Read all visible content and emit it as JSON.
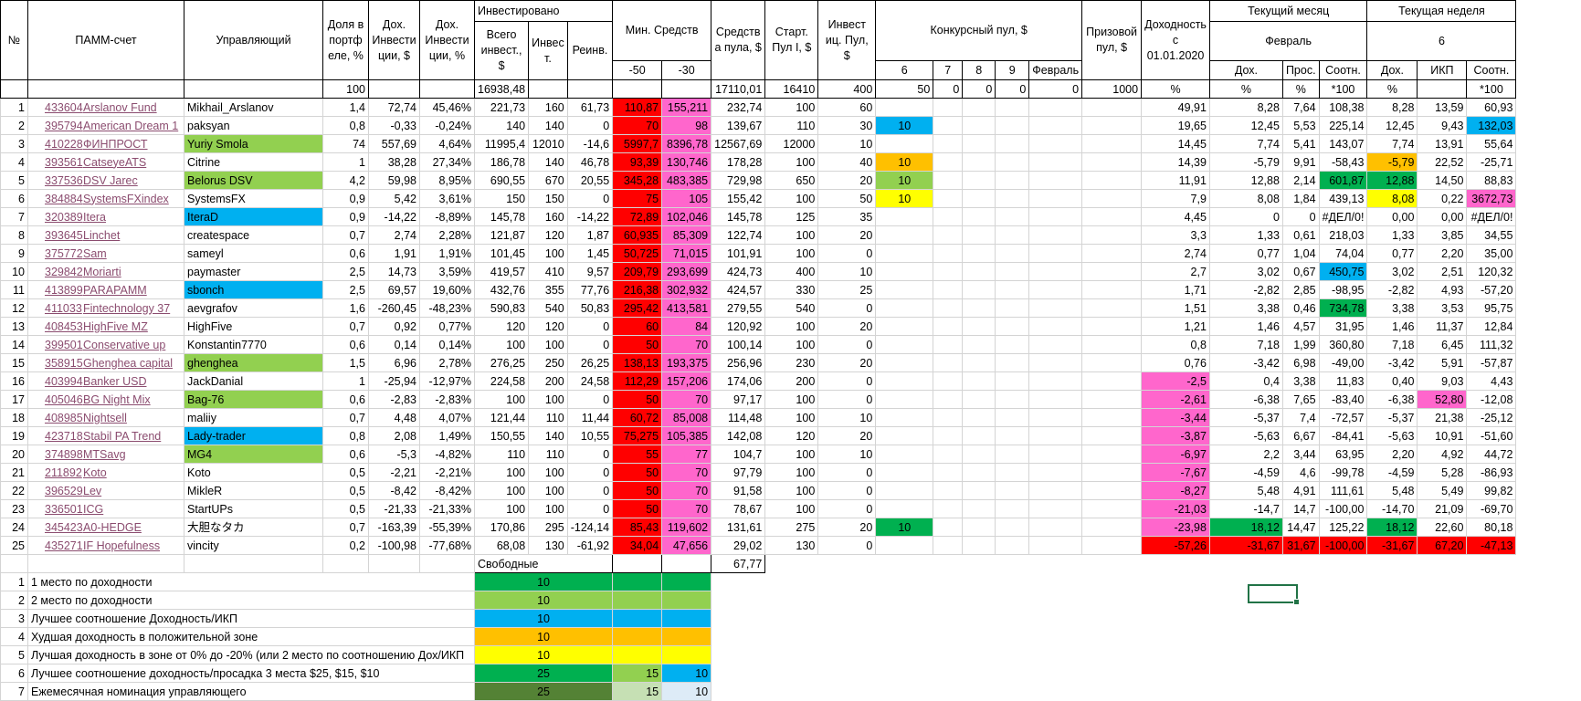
{
  "colors": {
    "dkgreen": "#00b050",
    "ltgreen": "#92d050",
    "blue": "#00b0f0",
    "orange": "#ffc000",
    "yellow": "#ffff00",
    "red": "#ff0000",
    "pink": "#ff66cc",
    "olive": "#548235",
    "pale_green": "#c6e0b4",
    "pale_blue": "#ddebf7"
  },
  "header": {
    "no": "№",
    "pamm": "ПАММ-счет",
    "manager": "Управляющий",
    "share": "Доля в портф еле, %",
    "inc_usd": "Дох. Инвести ции, $",
    "inc_pct": "Дох. Инвести ции, %",
    "invested": "Инвестировано",
    "total_inv": "Всего инвест., $",
    "invest": "Инвес т.",
    "reinv": "Реинв.",
    "min_funds": "Мин. Средств",
    "m50": "-50",
    "m30": "-30",
    "pool_funds": "Средств а пула, $",
    "start_pool": "Старт. Пул I, $",
    "inv_pool": "Инвест иц. Пул, $",
    "contest_pool": "Конкурсный пул, $",
    "c6": "6",
    "c7": "7",
    "c8": "8",
    "c9": "9",
    "feb": "Февраль",
    "prize_pool": "Призовой пул, $",
    "yield": "Доходность с 01.01.2020",
    "cur_month": "Текущий месяц",
    "month_name": "Февраль",
    "cur_week": "Текущая неделя",
    "week_no": "6",
    "m_inc": "Дох.",
    "m_dd": "Прос.",
    "m_ratio": "Соотн.",
    "w_inc": "Дох.",
    "w_ikp": "ИКП",
    "w_ratio": "Соотн."
  },
  "totals": [
    "100",
    "",
    "",
    "16938,48",
    "",
    "",
    "",
    "",
    "17110,01",
    "16410",
    "400",
    "50",
    "0",
    "0",
    "0",
    "0",
    "1000",
    "%",
    "%",
    "%",
    "*100",
    "%",
    "",
    "*100"
  ],
  "rows": [
    {
      "n": "1",
      "id": "433604",
      "name": "Arslanov Fund",
      "mgr": "Mikhail_Arslanov",
      "share": "1,4",
      "inc": "72,74",
      "pct": "45,46%",
      "tot": "221,73",
      "inv": "160",
      "reinv": "61,73",
      "m50": "110,87",
      "m30": "155,211",
      "pool": "232,74",
      "start": "100",
      "ip": "60",
      "c6": "",
      "yld": "49,91",
      "md": "8,28",
      "mp": "7,64",
      "mr": "108,38",
      "wd": "8,28",
      "wi": "13,59",
      "wr": "60,93"
    },
    {
      "n": "2",
      "id": "395794",
      "name": "American Dream 1",
      "mgr": "paksyan",
      "share": "0,8",
      "inc": "-0,33",
      "pct": "-0,24%",
      "tot": "140",
      "inv": "140",
      "reinv": "0",
      "m50": "70",
      "m30": "98",
      "pool": "139,67",
      "start": "110",
      "ip": "30",
      "c6": "10",
      "yld": "19,65",
      "md": "12,45",
      "mp": "5,53",
      "mr": "225,14",
      "wd": "12,45",
      "wi": "9,43",
      "wr": "132,03"
    },
    {
      "n": "3",
      "id": "410228",
      "name": "ФИНПРОСТ",
      "mgr": "Yuriy Smola",
      "share": "74",
      "inc": "557,69",
      "pct": "4,64%",
      "tot": "11995,4",
      "inv": "12010",
      "reinv": "-14,6",
      "m50": "5997,7",
      "m30": "8396,78",
      "pool": "12567,69",
      "start": "12000",
      "ip": "10",
      "c6": "",
      "yld": "14,45",
      "md": "7,74",
      "mp": "5,41",
      "mr": "143,07",
      "wd": "7,74",
      "wi": "13,91",
      "wr": "55,64"
    },
    {
      "n": "4",
      "id": "393561",
      "name": "CatseyeATS",
      "mgr": "Citrine",
      "share": "1",
      "inc": "38,28",
      "pct": "27,34%",
      "tot": "186,78",
      "inv": "140",
      "reinv": "46,78",
      "m50": "93,39",
      "m30": "130,746",
      "pool": "178,28",
      "start": "100",
      "ip": "40",
      "c6": "10",
      "yld": "14,39",
      "md": "-5,79",
      "mp": "9,91",
      "mr": "-58,43",
      "wd": "-5,79",
      "wi": "22,52",
      "wr": "-25,71"
    },
    {
      "n": "5",
      "id": "337536",
      "name": "DSV Jarec",
      "mgr": "Belorus DSV",
      "share": "4,2",
      "inc": "59,98",
      "pct": "8,95%",
      "tot": "690,55",
      "inv": "670",
      "reinv": "20,55",
      "m50": "345,28",
      "m30": "483,385",
      "pool": "729,98",
      "start": "650",
      "ip": "20",
      "c6": "10",
      "yld": "11,91",
      "md": "12,88",
      "mp": "2,14",
      "mr": "601,87",
      "wd": "12,88",
      "wi": "14,50",
      "wr": "88,83"
    },
    {
      "n": "6",
      "id": "384884",
      "name": "SystemsFXindex",
      "mgr": "SystemsFX",
      "share": "0,9",
      "inc": "5,42",
      "pct": "3,61%",
      "tot": "150",
      "inv": "150",
      "reinv": "0",
      "m50": "75",
      "m30": "105",
      "pool": "155,42",
      "start": "100",
      "ip": "50",
      "c6": "10",
      "yld": "7,9",
      "md": "8,08",
      "mp": "1,84",
      "mr": "439,13",
      "wd": "8,08",
      "wi": "0,22",
      "wr": "3672,73"
    },
    {
      "n": "7",
      "id": "320389",
      "name": "Itera",
      "mgr": "IteraD",
      "share": "0,9",
      "inc": "-14,22",
      "pct": "-8,89%",
      "tot": "145,78",
      "inv": "160",
      "reinv": "-14,22",
      "m50": "72,89",
      "m30": "102,046",
      "pool": "145,78",
      "start": "125",
      "ip": "35",
      "c6": "",
      "yld": "4,45",
      "md": "0",
      "mp": "0",
      "mr": "#ДЕЛ/0!",
      "wd": "0,00",
      "wi": "0,00",
      "wr": "#ДЕЛ/0!"
    },
    {
      "n": "8",
      "id": "393645",
      "name": "Linchet",
      "mgr": "createspace",
      "share": "0,7",
      "inc": "2,74",
      "pct": "2,28%",
      "tot": "121,87",
      "inv": "120",
      "reinv": "1,87",
      "m50": "60,935",
      "m30": "85,309",
      "pool": "122,74",
      "start": "100",
      "ip": "20",
      "c6": "",
      "yld": "3,3",
      "md": "1,33",
      "mp": "0,61",
      "mr": "218,03",
      "wd": "1,33",
      "wi": "3,85",
      "wr": "34,55"
    },
    {
      "n": "9",
      "id": "375772",
      "name": "Sam",
      "mgr": "sameyl",
      "share": "0,6",
      "inc": "1,91",
      "pct": "1,91%",
      "tot": "101,45",
      "inv": "100",
      "reinv": "1,45",
      "m50": "50,725",
      "m30": "71,015",
      "pool": "101,91",
      "start": "100",
      "ip": "0",
      "c6": "",
      "yld": "2,74",
      "md": "0,77",
      "mp": "1,04",
      "mr": "74,04",
      "wd": "0,77",
      "wi": "2,20",
      "wr": "35,00"
    },
    {
      "n": "10",
      "id": "329842",
      "name": "Moriarti",
      "mgr": "paymaster",
      "share": "2,5",
      "inc": "14,73",
      "pct": "3,59%",
      "tot": "419,57",
      "inv": "410",
      "reinv": "9,57",
      "m50": "209,79",
      "m30": "293,699",
      "pool": "424,73",
      "start": "400",
      "ip": "10",
      "c6": "",
      "yld": "2,7",
      "md": "3,02",
      "mp": "0,67",
      "mr": "450,75",
      "wd": "3,02",
      "wi": "2,51",
      "wr": "120,32"
    },
    {
      "n": "11",
      "id": "413899",
      "name": "PARAPAMM",
      "mgr": "sbonch",
      "share": "2,5",
      "inc": "69,57",
      "pct": "19,60%",
      "tot": "432,76",
      "inv": "355",
      "reinv": "77,76",
      "m50": "216,38",
      "m30": "302,932",
      "pool": "424,57",
      "start": "330",
      "ip": "25",
      "c6": "",
      "yld": "1,71",
      "md": "-2,82",
      "mp": "2,85",
      "mr": "-98,95",
      "wd": "-2,82",
      "wi": "4,93",
      "wr": "-57,20"
    },
    {
      "n": "12",
      "id": "411033",
      "name": "Fintechnology 37",
      "mgr": "aevgrafov",
      "share": "1,6",
      "inc": "-260,45",
      "pct": "-48,23%",
      "tot": "590,83",
      "inv": "540",
      "reinv": "50,83",
      "m50": "295,42",
      "m30": "413,581",
      "pool": "279,55",
      "start": "540",
      "ip": "0",
      "c6": "",
      "yld": "1,51",
      "md": "3,38",
      "mp": "0,46",
      "mr": "734,78",
      "wd": "3,38",
      "wi": "3,53",
      "wr": "95,75"
    },
    {
      "n": "13",
      "id": "408453",
      "name": "HighFive MZ",
      "mgr": "HighFive",
      "share": "0,7",
      "inc": "0,92",
      "pct": "0,77%",
      "tot": "120",
      "inv": "120",
      "reinv": "0",
      "m50": "60",
      "m30": "84",
      "pool": "120,92",
      "start": "100",
      "ip": "20",
      "c6": "",
      "yld": "1,21",
      "md": "1,46",
      "mp": "4,57",
      "mr": "31,95",
      "wd": "1,46",
      "wi": "11,37",
      "wr": "12,84"
    },
    {
      "n": "14",
      "id": "399501",
      "name": "Conservative up",
      "mgr": "Konstantin7770",
      "share": "0,6",
      "inc": "0,14",
      "pct": "0,14%",
      "tot": "100",
      "inv": "100",
      "reinv": "0",
      "m50": "50",
      "m30": "70",
      "pool": "100,14",
      "start": "100",
      "ip": "0",
      "c6": "",
      "yld": "0,8",
      "md": "7,18",
      "mp": "1,99",
      "mr": "360,80",
      "wd": "7,18",
      "wi": "6,45",
      "wr": "111,32"
    },
    {
      "n": "15",
      "id": "358915",
      "name": "Ghenghea capital",
      "mgr": "ghenghea",
      "share": "1,5",
      "inc": "6,96",
      "pct": "2,78%",
      "tot": "276,25",
      "inv": "250",
      "reinv": "26,25",
      "m50": "138,13",
      "m30": "193,375",
      "pool": "256,96",
      "start": "230",
      "ip": "20",
      "c6": "",
      "yld": "0,76",
      "md": "-3,42",
      "mp": "6,98",
      "mr": "-49,00",
      "wd": "-3,42",
      "wi": "5,91",
      "wr": "-57,87"
    },
    {
      "n": "16",
      "id": "403994",
      "name": "Banker USD",
      "mgr": "JackDanial",
      "share": "1",
      "inc": "-25,94",
      "pct": "-12,97%",
      "tot": "224,58",
      "inv": "200",
      "reinv": "24,58",
      "m50": "112,29",
      "m30": "157,206",
      "pool": "174,06",
      "start": "200",
      "ip": "0",
      "c6": "",
      "yld": "-2,5",
      "md": "0,4",
      "mp": "3,38",
      "mr": "11,83",
      "wd": "0,40",
      "wi": "9,03",
      "wr": "4,43"
    },
    {
      "n": "17",
      "id": "405046",
      "name": "BG Night Mix",
      "mgr": "Bag-76",
      "share": "0,6",
      "inc": "-2,83",
      "pct": "-2,83%",
      "tot": "100",
      "inv": "100",
      "reinv": "0",
      "m50": "50",
      "m30": "70",
      "pool": "97,17",
      "start": "100",
      "ip": "0",
      "c6": "",
      "yld": "-2,61",
      "md": "-6,38",
      "mp": "7,65",
      "mr": "-83,40",
      "wd": "-6,38",
      "wi": "52,80",
      "wr": "-12,08"
    },
    {
      "n": "18",
      "id": "408985",
      "name": "Nightsell",
      "mgr": "maliiy",
      "share": "0,7",
      "inc": "4,48",
      "pct": "4,07%",
      "tot": "121,44",
      "inv": "110",
      "reinv": "11,44",
      "m50": "60,72",
      "m30": "85,008",
      "pool": "114,48",
      "start": "100",
      "ip": "10",
      "c6": "",
      "yld": "-3,44",
      "md": "-5,37",
      "mp": "7,4",
      "mr": "-72,57",
      "wd": "-5,37",
      "wi": "21,38",
      "wr": "-25,12"
    },
    {
      "n": "19",
      "id": "423718",
      "name": "Stabil PA Trend",
      "mgr": "Lady-trader",
      "share": "0,8",
      "inc": "2,08",
      "pct": "1,49%",
      "tot": "150,55",
      "inv": "140",
      "reinv": "10,55",
      "m50": "75,275",
      "m30": "105,385",
      "pool": "142,08",
      "start": "120",
      "ip": "20",
      "c6": "",
      "yld": "-3,87",
      "md": "-5,63",
      "mp": "6,67",
      "mr": "-84,41",
      "wd": "-5,63",
      "wi": "10,91",
      "wr": "-51,60"
    },
    {
      "n": "20",
      "id": "374898",
      "name": "MTSavg",
      "mgr": "MG4",
      "share": "0,6",
      "inc": "-5,3",
      "pct": "-4,82%",
      "tot": "110",
      "inv": "110",
      "reinv": "0",
      "m50": "55",
      "m30": "77",
      "pool": "104,7",
      "start": "100",
      "ip": "10",
      "c6": "",
      "yld": "-6,97",
      "md": "2,2",
      "mp": "3,44",
      "mr": "63,95",
      "wd": "2,20",
      "wi": "4,92",
      "wr": "44,72"
    },
    {
      "n": "21",
      "id": "211892",
      "name": "Koto",
      "mgr": "Koto",
      "share": "0,5",
      "inc": "-2,21",
      "pct": "-2,21%",
      "tot": "100",
      "inv": "100",
      "reinv": "0",
      "m50": "50",
      "m30": "70",
      "pool": "97,79",
      "start": "100",
      "ip": "0",
      "c6": "",
      "yld": "-7,67",
      "md": "-4,59",
      "mp": "4,6",
      "mr": "-99,78",
      "wd": "-4,59",
      "wi": "5,28",
      "wr": "-86,93"
    },
    {
      "n": "22",
      "id": "396529",
      "name": "Lev",
      "mgr": "MikleR",
      "share": "0,5",
      "inc": "-8,42",
      "pct": "-8,42%",
      "tot": "100",
      "inv": "100",
      "reinv": "0",
      "m50": "50",
      "m30": "70",
      "pool": "91,58",
      "start": "100",
      "ip": "0",
      "c6": "",
      "yld": "-8,27",
      "md": "5,48",
      "mp": "4,91",
      "mr": "111,61",
      "wd": "5,48",
      "wi": "5,49",
      "wr": "99,82"
    },
    {
      "n": "23",
      "id": "336501",
      "name": "ICG",
      "mgr": "StartUPs",
      "share": "0,5",
      "inc": "-21,33",
      "pct": "-21,33%",
      "tot": "100",
      "inv": "100",
      "reinv": "0",
      "m50": "50",
      "m30": "70",
      "pool": "78,67",
      "start": "100",
      "ip": "0",
      "c6": "",
      "yld": "-21,03",
      "md": "-14,7",
      "mp": "14,7",
      "mr": "-100,00",
      "wd": "-14,70",
      "wi": "21,09",
      "wr": "-69,70"
    },
    {
      "n": "24",
      "id": "345423",
      "name": "A0-HEDGE",
      "mgr": "大胆なタカ",
      "share": "0,7",
      "inc": "-163,39",
      "pct": "-55,39%",
      "tot": "170,86",
      "inv": "295",
      "reinv": "-124,14",
      "m50": "85,43",
      "m30": "119,602",
      "pool": "131,61",
      "start": "275",
      "ip": "20",
      "c6": "10",
      "yld": "-23,98",
      "md": "18,12",
      "mp": "14,47",
      "mr": "125,22",
      "wd": "18,12",
      "wi": "22,60",
      "wr": "80,18"
    },
    {
      "n": "25",
      "id": "435271",
      "name": "IF Hopefulness",
      "mgr": "vincity",
      "share": "0,2",
      "inc": "-100,98",
      "pct": "-77,68%",
      "tot": "68,08",
      "inv": "130",
      "reinv": "-61,92",
      "m50": "34,04",
      "m30": "47,656",
      "pool": "29,02",
      "start": "130",
      "ip": "0",
      "c6": "",
      "yld": "-57,26",
      "md": "-31,67",
      "mp": "31,67",
      "mr": "-100,00",
      "wd": "-31,67",
      "wi": "67,20",
      "wr": "-47,13"
    }
  ],
  "free": {
    "label": "Свободные",
    "value": "67,77"
  },
  "legend": [
    {
      "n": "1",
      "text": "1 место по доходности",
      "v1": "10",
      "v2": "",
      "v3": ""
    },
    {
      "n": "2",
      "text": "2 место по доходности",
      "v1": "10",
      "v2": "",
      "v3": ""
    },
    {
      "n": "3",
      "text": "Лучшее соотношение Доходность/ИКП",
      "v1": "10",
      "v2": "",
      "v3": ""
    },
    {
      "n": "4",
      "text": "Худшая доходность в положительной зоне",
      "v1": "10",
      "v2": "",
      "v3": ""
    },
    {
      "n": "5",
      "text": "Лучшая доходность в зоне от 0% до -20% (или 2 место по соотношению Дох/ИКП",
      "v1": "10",
      "v2": "",
      "v3": ""
    },
    {
      "n": "6",
      "text": "Лучшее соотношение доходность/просадка 3 места $25, $15, $10",
      "v1": "25",
      "v2": "15",
      "v3": "10"
    },
    {
      "n": "7",
      "text": "Ежемесячная номинация управляющего",
      "v1": "25",
      "v2": "15",
      "v3": "10"
    }
  ]
}
